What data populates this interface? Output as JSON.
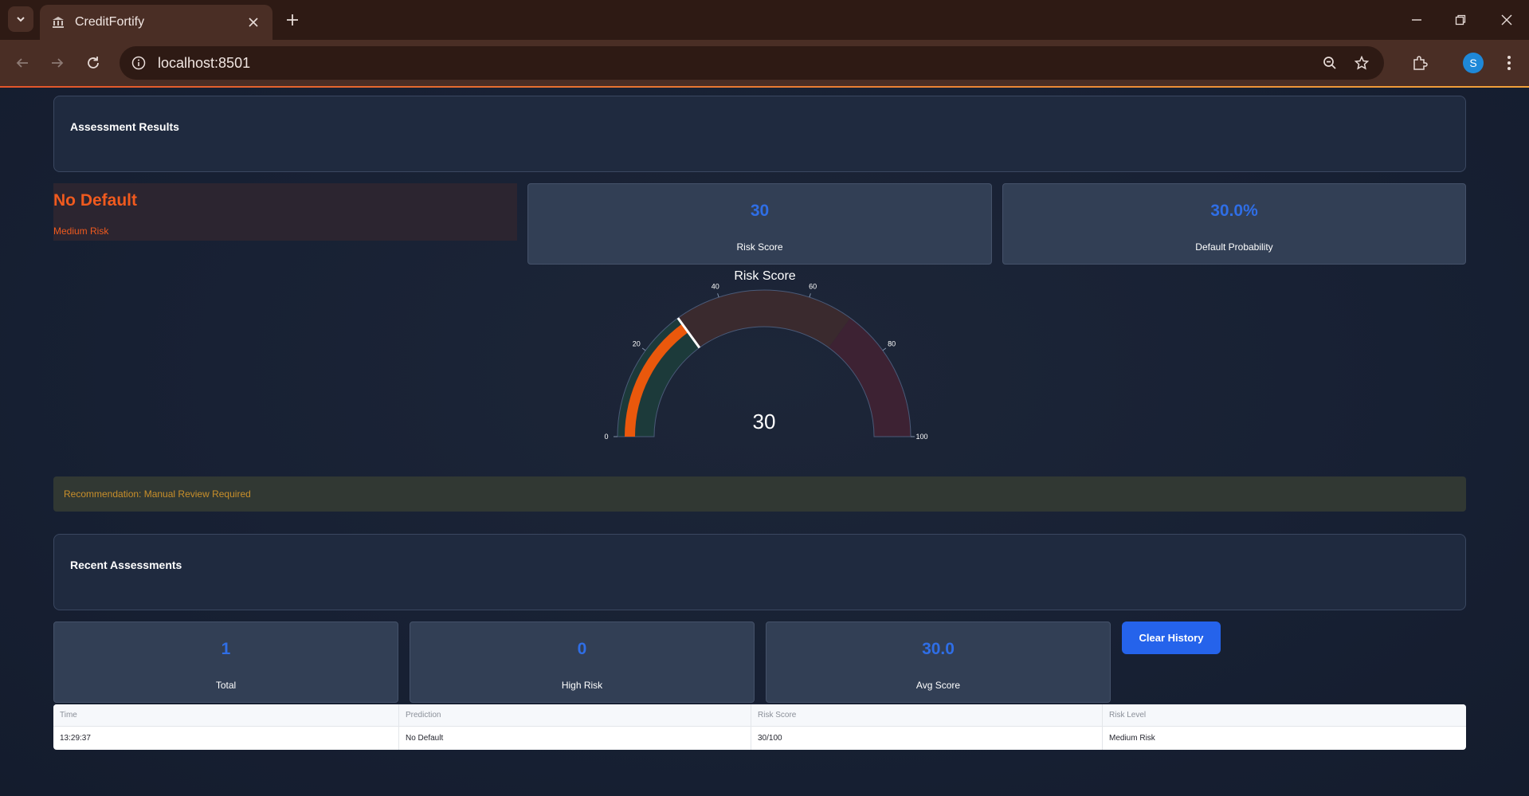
{
  "browser": {
    "tab_title": "CreditFortify",
    "url": "localhost:8501",
    "profile_initial": "S"
  },
  "assessment": {
    "section_title": "Assessment Results",
    "prediction": "No Default",
    "risk_level": "Medium Risk",
    "risk_score_value": "30",
    "risk_score_label": "Risk Score",
    "default_prob_value": "30.0%",
    "default_prob_label": "Default Probability"
  },
  "gauge": {
    "title": "Risk Score",
    "value": 30,
    "value_text": "30",
    "min": 0,
    "max": 100,
    "tick_labels": [
      "0",
      "20",
      "40",
      "60",
      "80",
      "100"
    ],
    "bands": [
      {
        "from": 0,
        "to": 30,
        "color": "#1c3a3a"
      },
      {
        "from": 30,
        "to": 70,
        "color": "#3a2a2e"
      },
      {
        "from": 70,
        "to": 100,
        "color": "#3d2233"
      }
    ],
    "bar_color": "#ea580c",
    "threshold": 30
  },
  "recommendation": "Recommendation: Manual Review Required",
  "recent": {
    "section_title": "Recent Assessments",
    "total_value": "1",
    "total_label": "Total",
    "high_value": "0",
    "high_label": "High Risk",
    "avg_value": "30.0",
    "avg_label": "Avg Score",
    "clear_label": "Clear History"
  },
  "table": {
    "headers": [
      "Time",
      "Prediction",
      "Risk Score",
      "Risk Level"
    ],
    "rows": [
      [
        "13:29:37",
        "No Default",
        "30/100",
        "Medium Risk"
      ]
    ]
  },
  "colors": {
    "accent": "#2563eb",
    "prediction": "#f05a1e",
    "metric_value": "#2f6ee6"
  }
}
